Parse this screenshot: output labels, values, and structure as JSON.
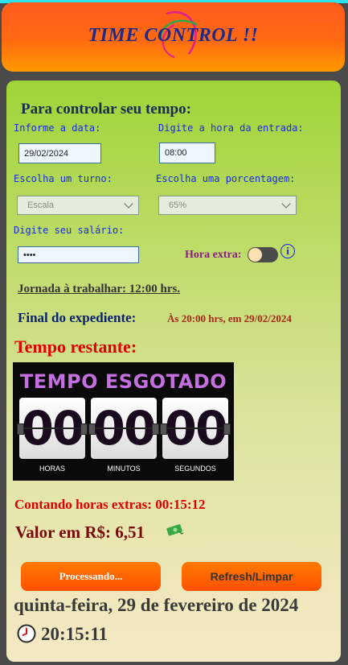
{
  "header": {
    "title": "TIME CONTROL !!"
  },
  "form": {
    "intro": "Para controlar seu tempo:",
    "date_label": "Informe a data:",
    "date_value": "29/02/2024",
    "entry_label": "Digite a hora da entrada:",
    "entry_value": "08:00",
    "shift_label": "Escolha um turno:",
    "shift_value": "Escala",
    "percent_label": "Escolha uma porcentagem:",
    "percent_value": "65%",
    "salary_label": "Digite seu salário:",
    "salary_value": "••••",
    "overtime_label": "Hora extra:",
    "overtime_toggle_on": false,
    "info_icon": "info-icon"
  },
  "summary": {
    "jornada": "Jornada à trabalhar: 12:00 hrs.",
    "final_label": "Final do expediente:",
    "final_value": "Às 20:00 hrs, em 29/02/2024",
    "restante_label": "Tempo restante:"
  },
  "timer": {
    "title": "TEMPO ESGOTADO",
    "hours": "00",
    "minutes": "00",
    "seconds": "00",
    "hours_label": "HORAS",
    "minutes_label": "MINUTOS",
    "seconds_label": "SEGUNDOS"
  },
  "extras": {
    "counting": "Contando horas extras: 00:15:12",
    "valor": "Valor em R$: 6,51",
    "money_icon": "money-icon"
  },
  "buttons": {
    "processing": "Processando...",
    "refresh": "Refresh/Limpar"
  },
  "footer": {
    "date": "quinta-feira, 29 de fevereiro de 2024",
    "time": "20:15:11",
    "clock_icon": "clock-icon"
  },
  "colors": {
    "header": "#ff6a10",
    "panel_top": "#9fd437",
    "panel_bottom": "#f6e9c6",
    "label_blue": "#1a2ae0",
    "alert_red": "#e00000",
    "timer_purple": "#c46fe0"
  }
}
